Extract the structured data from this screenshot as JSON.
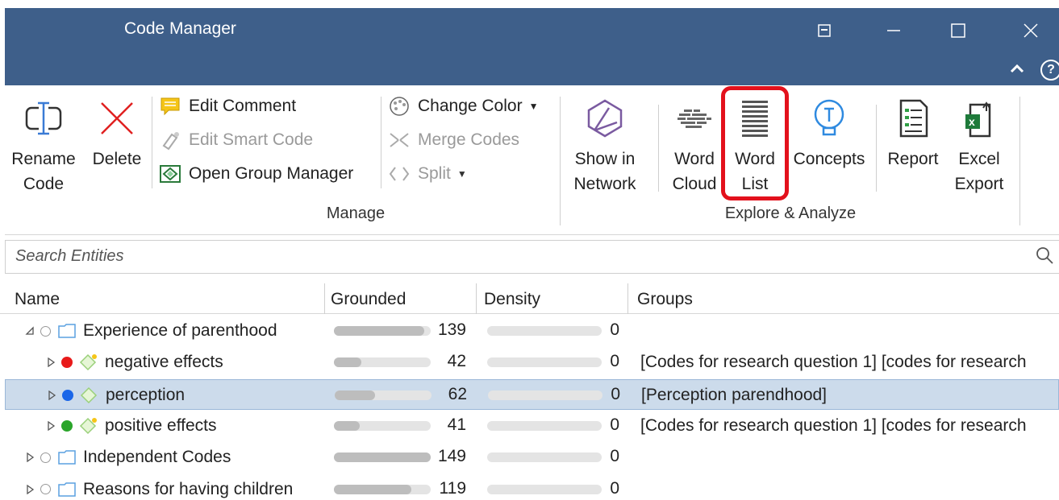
{
  "window": {
    "title": "Code Manager"
  },
  "ribbon": {
    "rename_code": "Rename Code",
    "delete": "Delete",
    "edit_comment": "Edit Comment",
    "edit_smart_code": "Edit Smart Code",
    "open_group_manager": "Open Group Manager",
    "change_color": "Change Color",
    "merge_codes": "Merge Codes",
    "split": "Split",
    "group_manage": "Manage",
    "show_in_network_1": "Show in",
    "show_in_network_2": "Network",
    "word_cloud_1": "Word",
    "word_cloud_2": "Cloud",
    "word_list_1": "Word",
    "word_list_2": "List",
    "concepts": "Concepts",
    "report": "Report",
    "excel_export_1": "Excel",
    "excel_export_2": "Export",
    "group_explore": "Explore & Analyze",
    "highlight_color": "#e3111c"
  },
  "search": {
    "placeholder": "Search Entities"
  },
  "table": {
    "columns": [
      "Name",
      "Grounded",
      "Density",
      "Groups"
    ],
    "rows": [
      {
        "name": "Experience of parenthood",
        "type": "folder",
        "expander": "expanded",
        "grounded": 139,
        "grounded_fraction": 0.93,
        "density": "0",
        "groups": "",
        "indent": 0,
        "dot": "hollow"
      },
      {
        "name": "negative effects",
        "type": "code",
        "expander": "collapsed",
        "grounded": 42,
        "grounded_fraction": 0.28,
        "density": "0",
        "groups": "[Codes for research question 1] [codes for research",
        "indent": 1,
        "dot": "#e81a1a",
        "badge": true
      },
      {
        "name": "perception",
        "type": "code",
        "expander": "collapsed",
        "grounded": 62,
        "grounded_fraction": 0.42,
        "density": "0",
        "groups": "[Perception parendhood]",
        "indent": 1,
        "dot": "#1a66e8",
        "badge": false,
        "selected": true
      },
      {
        "name": "positive effects",
        "type": "code",
        "expander": "collapsed",
        "grounded": 41,
        "grounded_fraction": 0.27,
        "density": "0",
        "groups": "[Codes for research question 1] [codes for research",
        "indent": 1,
        "dot": "#2aa52a",
        "badge": true
      },
      {
        "name": "Independent Codes",
        "type": "folder",
        "expander": "collapsed",
        "grounded": 149,
        "grounded_fraction": 1.0,
        "density": "0",
        "groups": "",
        "indent": 0,
        "dot": "hollow"
      },
      {
        "name": "Reasons for having children",
        "type": "folder",
        "expander": "collapsed",
        "grounded": 119,
        "grounded_fraction": 0.8,
        "density": "0",
        "groups": "",
        "indent": 0,
        "dot": "hollow"
      }
    ]
  }
}
